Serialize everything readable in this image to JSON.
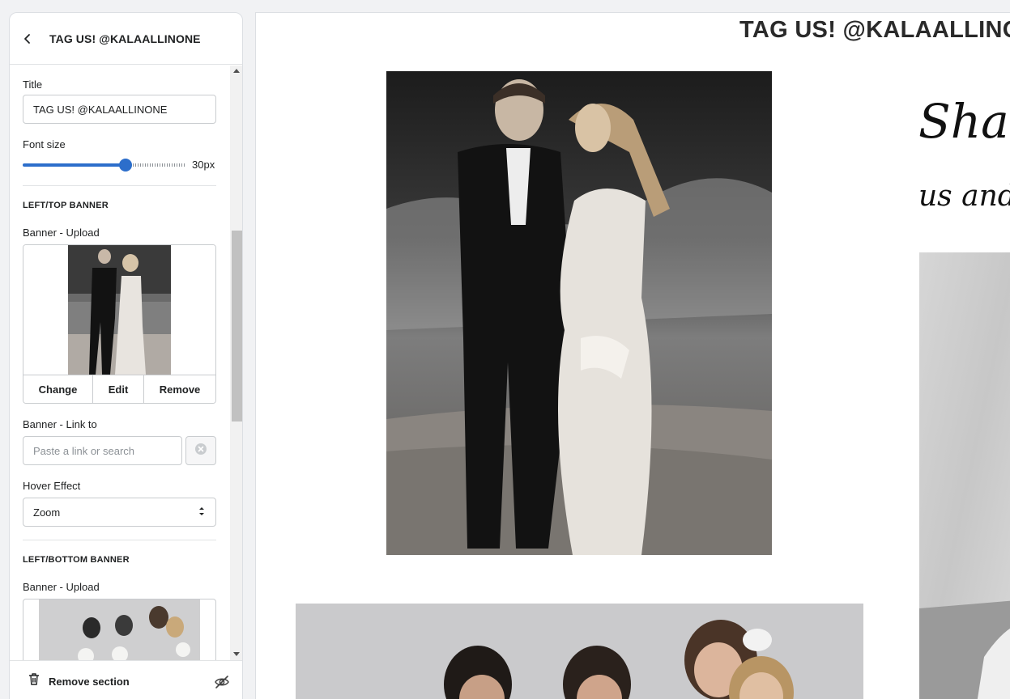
{
  "sidebar": {
    "title": "TAG US! @KALAALLINONE",
    "fields": {
      "title_label": "Title",
      "title_value": "TAG US! @KALAALLINONE",
      "font_size_label": "Font size",
      "font_size_value": "30px",
      "font_size_fraction": 0.63
    },
    "left_top_banner": {
      "heading": "LEFT/TOP BANNER",
      "upload_label": "Banner - Upload",
      "actions": [
        "Change",
        "Edit",
        "Remove"
      ],
      "link_label": "Banner - Link to",
      "link_placeholder": "Paste a link or search",
      "hover_label": "Hover Effect",
      "hover_value": "Zoom"
    },
    "left_bottom_banner": {
      "heading": "LEFT/BOTTOM BANNER",
      "upload_label": "Banner - Upload"
    },
    "footer": {
      "remove_label": "Remove section"
    }
  },
  "preview": {
    "title": "TAG US! @KALAALLINONE",
    "script_line_1": "Shar",
    "script_line_2": "us and"
  },
  "colors": {
    "accent": "#2c6ecb",
    "text": "#202223",
    "border": "#c9cccf"
  },
  "icons": {
    "back": "chevron-left-icon",
    "clear": "circle-x-icon",
    "select": "select-arrows-icon",
    "trash": "trash-icon",
    "hide": "eye-off-icon"
  }
}
